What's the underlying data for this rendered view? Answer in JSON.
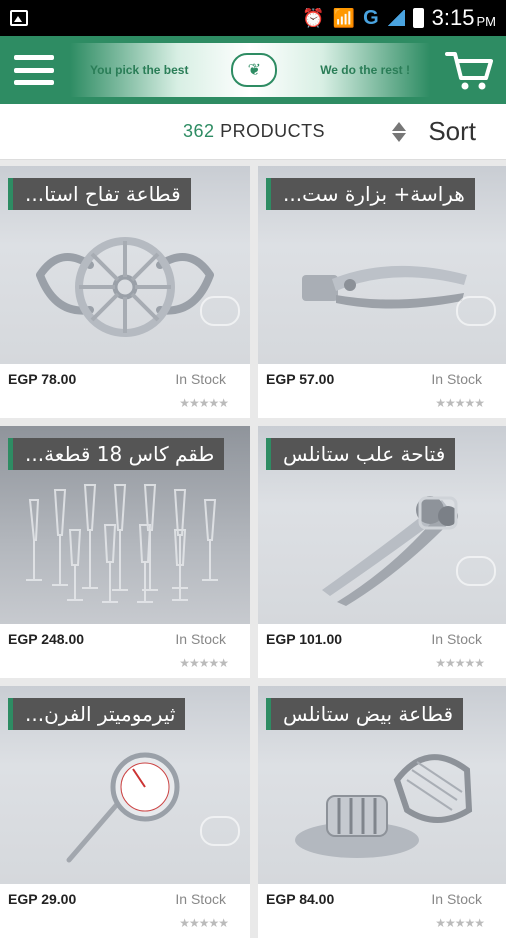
{
  "status": {
    "time": "3:15",
    "ampm": "PM",
    "network": "G"
  },
  "header": {
    "tag_left": "You pick the best",
    "tag_right": "We do the rest !"
  },
  "toolbar": {
    "count": "362",
    "count_label": "PRODUCTS",
    "sort_label": "Sort"
  },
  "products": [
    {
      "title": "قطاعة تفاح استا...",
      "price": "EGP 78.00",
      "stock": "In Stock",
      "stars": "★★★★★",
      "icon": "apple-slicer-icon"
    },
    {
      "title": "هراسة+ بزارة ست...",
      "price": "EGP 57.00",
      "stock": "In Stock",
      "stars": "★★★★★",
      "icon": "garlic-press-icon"
    },
    {
      "title": "طقم كاس 18 قطعة...",
      "price": "EGP 248.00",
      "stock": "In Stock",
      "stars": "★★★★★",
      "icon": "glass-set-icon"
    },
    {
      "title": "فتاحة علب ستانلس",
      "price": "EGP 101.00",
      "stock": "In Stock",
      "stars": "★★★★★",
      "icon": "can-opener-icon"
    },
    {
      "title": "ثيرموميتر الفرن...",
      "price": "EGP 29.00",
      "stock": "In Stock",
      "stars": "★★★★★",
      "icon": "thermometer-icon"
    },
    {
      "title": "قطاعة بيض ستانلس",
      "price": "EGP 84.00",
      "stock": "In Stock",
      "stars": "★★★★★",
      "icon": "egg-slicer-icon"
    }
  ],
  "colors": {
    "brand": "#2e8c63",
    "title_bg": "#555555"
  }
}
